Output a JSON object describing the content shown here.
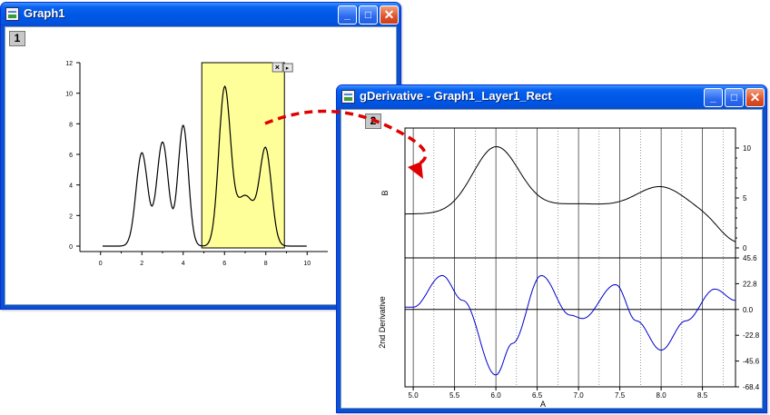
{
  "window1": {
    "title": "Graph1",
    "layer_label": "1",
    "buttons": {
      "minimize": "_",
      "maximize": "□",
      "close": "✕"
    }
  },
  "window2": {
    "title": "gDerivative - Graph1_Layer1_Rect",
    "layer_label": "2",
    "buttons": {
      "minimize": "_",
      "maximize": "□",
      "close": "✕"
    }
  },
  "rect_controls": {
    "close": "×",
    "menu": "▸"
  },
  "colors": {
    "titlebar": "#0058e6",
    "highlight_rect": "#ffff99",
    "arrow": "#e00000",
    "curve_black": "#000000",
    "curve_blue": "#0000cc"
  },
  "chart_data": [
    {
      "type": "line",
      "title": "",
      "x_ticks": [
        "0",
        "2",
        "4",
        "6",
        "8",
        "10"
      ],
      "y_ticks": [
        "0",
        "2",
        "4",
        "6",
        "8",
        "10",
        "12"
      ],
      "xlim": [
        -1,
        11
      ],
      "ylim": [
        0,
        12
      ],
      "peaks": [
        {
          "x": 2,
          "y": 6.1
        },
        {
          "x": 3,
          "y": 7.4
        },
        {
          "x": 4,
          "y": 8.3
        },
        {
          "x": 6,
          "y": 10.2
        },
        {
          "x": 8,
          "y": 6.1
        }
      ],
      "highlight_range": [
        4.9,
        8.9
      ]
    },
    {
      "type": "line",
      "ylabel": "B",
      "x_ticks": [
        "5.0",
        "5.5",
        "6.0",
        "6.5",
        "7.0",
        "7.5",
        "8.0",
        "8.5"
      ],
      "y_ticks": [
        "10",
        "5",
        "0"
      ],
      "xlim": [
        4.9,
        8.9
      ],
      "ylim": [
        -1,
        12
      ],
      "points": [
        [
          4.9,
          3.5
        ],
        [
          5.2,
          3.6
        ],
        [
          5.5,
          5.2
        ],
        [
          6.0,
          10.0
        ],
        [
          6.5,
          5.0
        ],
        [
          7.0,
          4.4
        ],
        [
          7.5,
          4.0
        ],
        [
          8.0,
          6.0
        ],
        [
          8.5,
          4.0
        ],
        [
          8.9,
          0.2
        ]
      ]
    },
    {
      "type": "line",
      "ylabel": "2nd Derivative",
      "xlabel": "A",
      "x_ticks": [
        "5.0",
        "5.5",
        "6.0",
        "6.5",
        "7.0",
        "7.5",
        "8.0",
        "8.5"
      ],
      "y_ticks": [
        "45.6",
        "22.8",
        "0.0",
        "-22.8",
        "-45.6",
        "-68.4"
      ],
      "xlim": [
        4.9,
        8.9
      ],
      "ylim": [
        -68.4,
        45.6
      ],
      "points": [
        [
          4.9,
          2
        ],
        [
          5.0,
          2
        ],
        [
          5.35,
          30
        ],
        [
          5.6,
          8
        ],
        [
          6.0,
          -58
        ],
        [
          6.2,
          -30
        ],
        [
          6.55,
          30
        ],
        [
          6.9,
          -5
        ],
        [
          7.05,
          -8
        ],
        [
          7.45,
          22
        ],
        [
          7.7,
          -10
        ],
        [
          8.0,
          -36
        ],
        [
          8.3,
          -10
        ],
        [
          8.65,
          18
        ],
        [
          8.9,
          8
        ]
      ]
    }
  ]
}
